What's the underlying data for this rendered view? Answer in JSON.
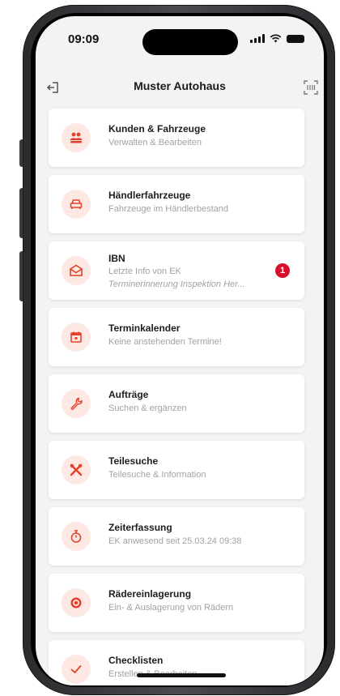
{
  "status_bar": {
    "time": "09:09"
  },
  "nav": {
    "title": "Muster Autohaus",
    "left_icon": "logout-icon",
    "right_icon": "scan-icon"
  },
  "colors": {
    "accent": "#e3412a",
    "icon_bg": "#fde8e4",
    "badge": "#d6102a"
  },
  "menu": [
    {
      "icon": "people-icon",
      "title": "Kunden & Fahrzeuge",
      "subtitle": "Verwalten & Bearbeiten"
    },
    {
      "icon": "car-icon",
      "title": "Händlerfahrzeuge",
      "subtitle": "Fahrzeuge im Händlerbestand"
    },
    {
      "icon": "mail-open-icon",
      "title": "IBN",
      "subtitle": "Letzte Info von EK",
      "subtitle2": "Terminerinnerung Inspektion Her...",
      "badge": "1"
    },
    {
      "icon": "calendar-icon",
      "title": "Terminkalender",
      "subtitle": "Keine anstehenden Termine!"
    },
    {
      "icon": "wrench-icon",
      "title": "Aufträge",
      "subtitle": "Suchen & ergänzen"
    },
    {
      "icon": "tools-icon",
      "title": "Teilesuche",
      "subtitle": "Teilesuche & Information"
    },
    {
      "icon": "stopwatch-icon",
      "title": "Zeiterfassung",
      "subtitle": "EK anwesend seit 25.03.24 09:38"
    },
    {
      "icon": "tire-icon",
      "title": "Rädereinlagerung",
      "subtitle": "Ein- & Auslagerung von Rädern"
    },
    {
      "icon": "checkmark-icon",
      "title": "Checklisten",
      "subtitle": "Erstellen & Bearbeiten"
    }
  ]
}
